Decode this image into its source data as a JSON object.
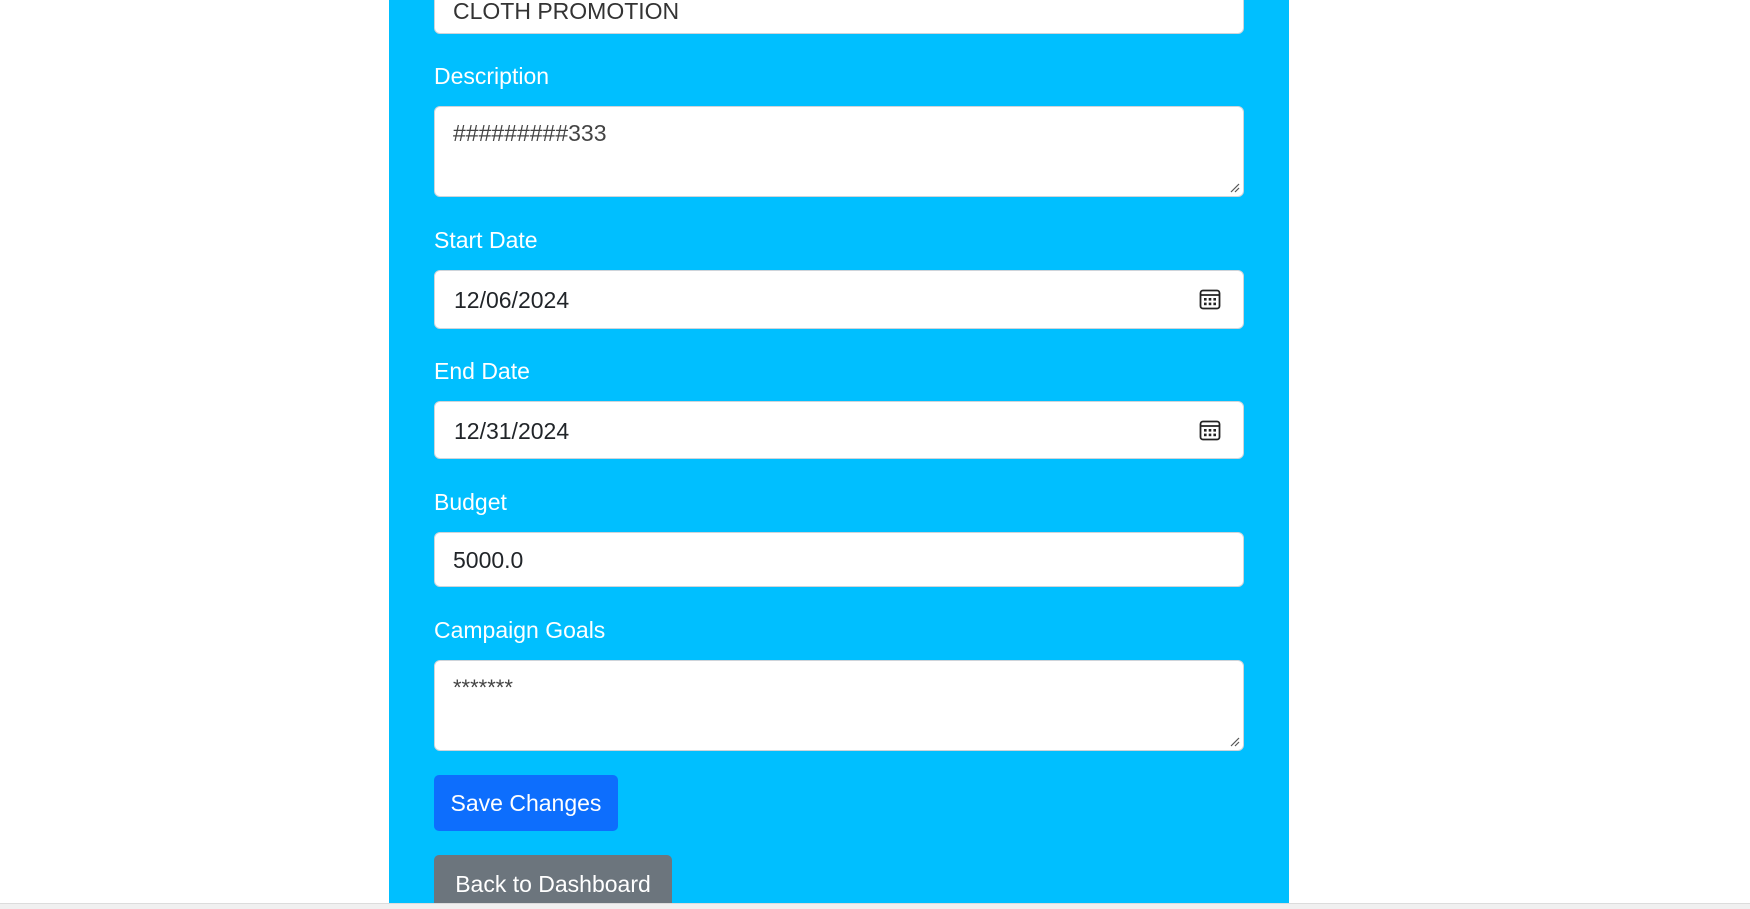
{
  "form": {
    "name_value": "CLOTH PROMOTION",
    "description_label": "Description",
    "description_value": "#########333",
    "start_date_label": "Start Date",
    "start_date_value": "12/06/2024",
    "end_date_label": "End Date",
    "end_date_value": "12/31/2024",
    "budget_label": "Budget",
    "budget_value": "5000.0",
    "goals_label": "Campaign Goals",
    "goals_value": "*******"
  },
  "actions": {
    "save_label": "Save Changes",
    "back_label": "Back to Dashboard"
  },
  "colors": {
    "panel_background": "#00bfff",
    "primary_button": "#0d6efd",
    "secondary_button": "#6c757d",
    "label_text": "#ffffff"
  },
  "icons": {
    "date_picker": "calendar-icon",
    "textarea_resize": "resize-grip-icon"
  }
}
